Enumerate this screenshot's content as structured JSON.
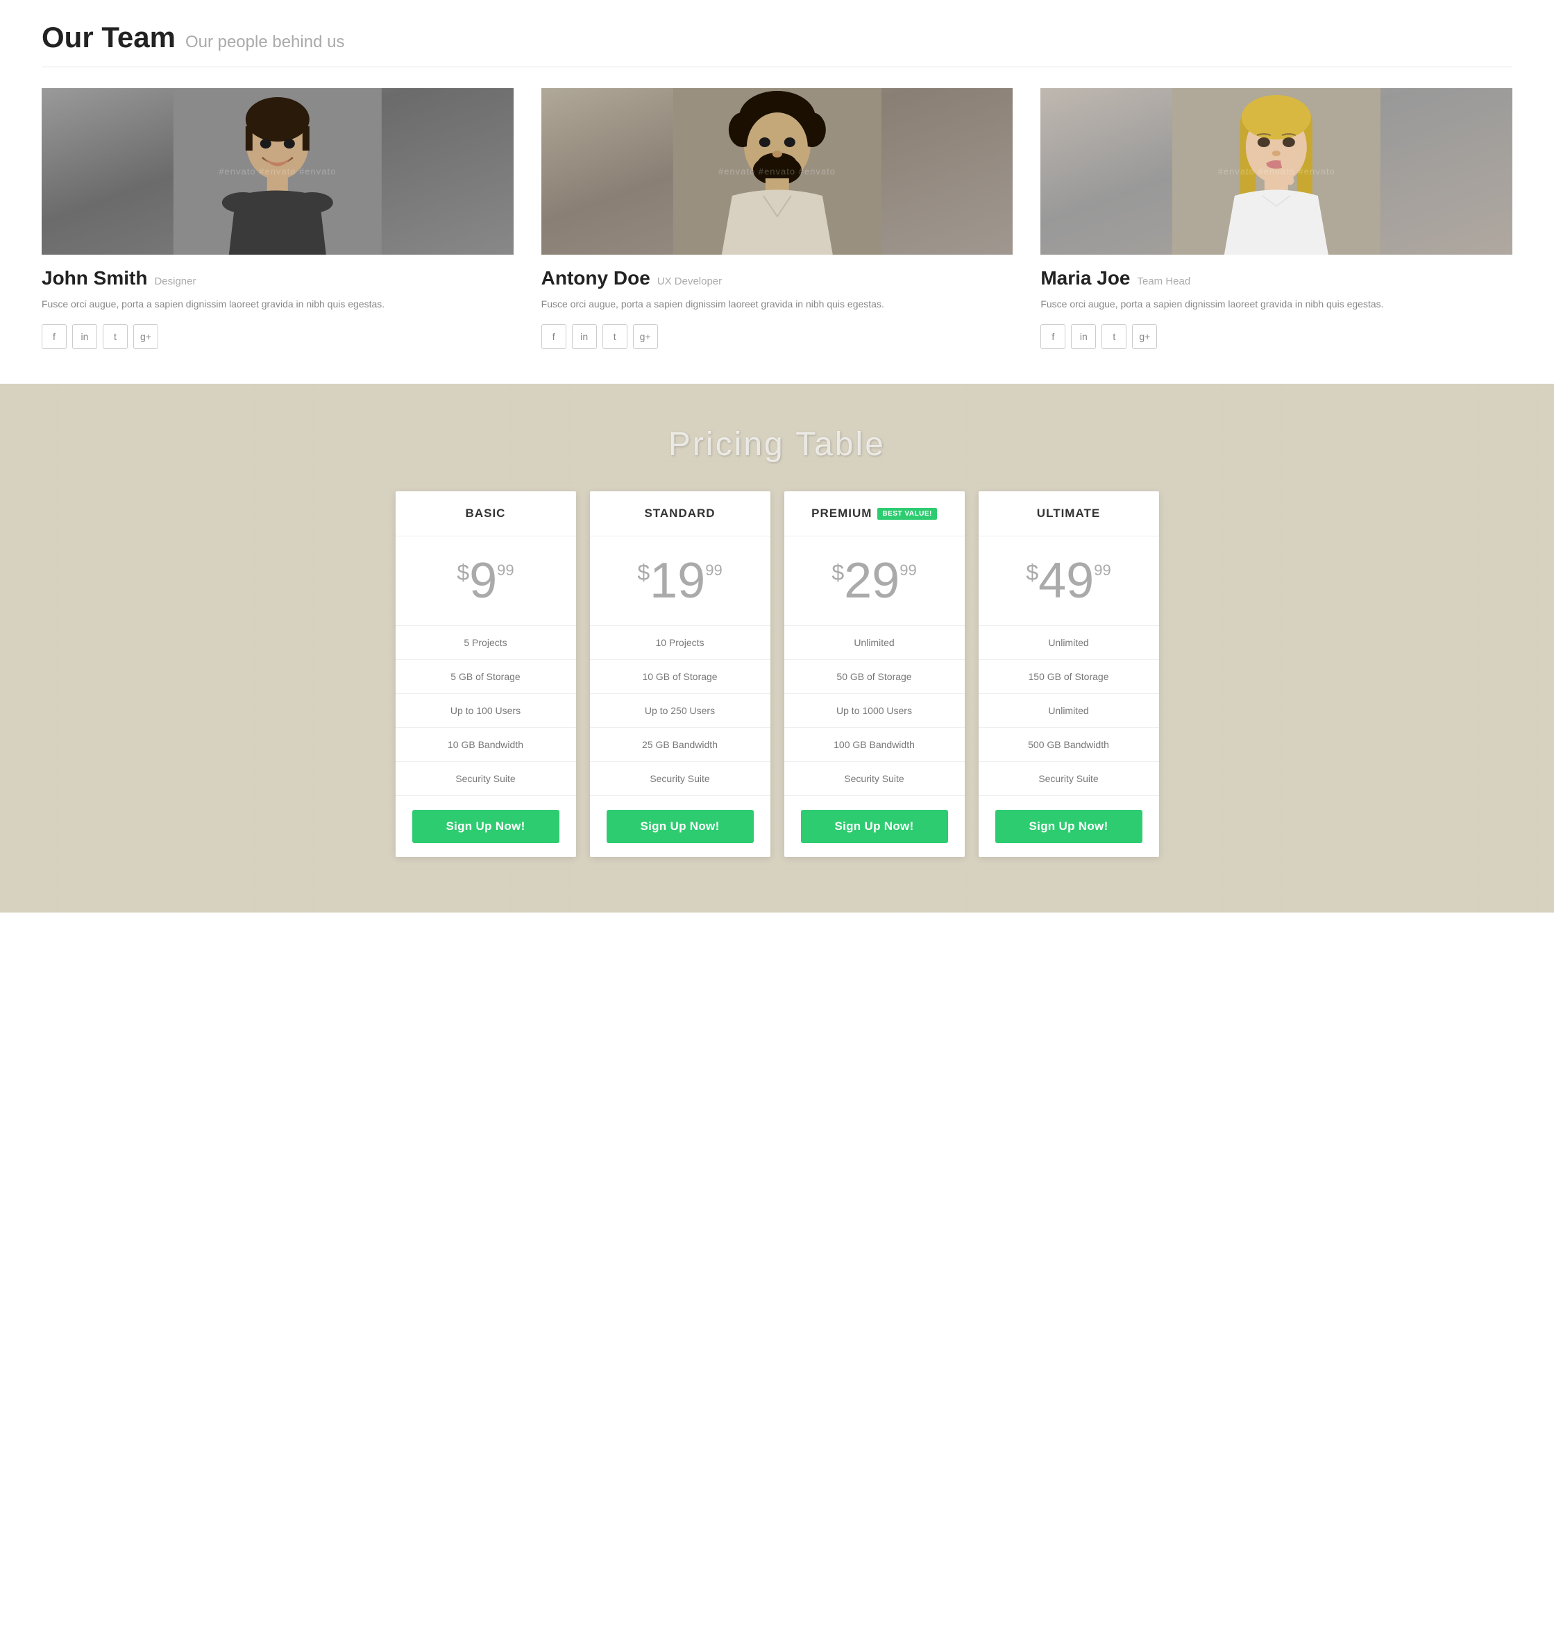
{
  "team": {
    "section_title": "Our Team",
    "section_subtitle": "Our people behind us",
    "members": [
      {
        "id": "john-smith",
        "name": "John Smith",
        "role": "Designer",
        "bio": "Fusce orci augue, porta a sapien dignissim laoreet gravida in nibh quis egestas.",
        "photo_class": "photo-john"
      },
      {
        "id": "antony-doe",
        "name": "Antony Doe",
        "role": "UX Developer",
        "bio": "Fusce orci augue, porta a sapien dignissim laoreet gravida in nibh quis egestas.",
        "photo_class": "photo-antony"
      },
      {
        "id": "maria-joe",
        "name": "Maria Joe",
        "role": "Team Head",
        "bio": "Fusce orci augue, porta a sapien dignissim laoreet gravida in nibh quis egestas.",
        "photo_class": "photo-maria"
      }
    ],
    "social_links": [
      "f",
      "in",
      "t",
      "g+"
    ]
  },
  "pricing": {
    "section_title": "Pricing Table",
    "plans": [
      {
        "id": "basic",
        "name": "BASIC",
        "badge": null,
        "price_dollar": "$",
        "price_main": "9",
        "price_cents": "99",
        "features": [
          "5 Projects",
          "5 GB of Storage",
          "Up to 100 Users",
          "10 GB Bandwidth",
          "Security Suite"
        ],
        "cta": "Sign Up Now!"
      },
      {
        "id": "standard",
        "name": "STANDARD",
        "badge": null,
        "price_dollar": "$",
        "price_main": "19",
        "price_cents": "99",
        "features": [
          "10 Projects",
          "10 GB of Storage",
          "Up to 250 Users",
          "25 GB Bandwidth",
          "Security Suite"
        ],
        "cta": "Sign Up Now!"
      },
      {
        "id": "premium",
        "name": "PREMIUM",
        "badge": "BEST VALUE!",
        "price_dollar": "$",
        "price_main": "29",
        "price_cents": "99",
        "features": [
          "Unlimited",
          "50 GB of Storage",
          "Up to 1000 Users",
          "100 GB Bandwidth",
          "Security Suite"
        ],
        "cta": "Sign Up Now!"
      },
      {
        "id": "ultimate",
        "name": "ULTIMATE",
        "badge": null,
        "price_dollar": "$",
        "price_main": "49",
        "price_cents": "99",
        "features": [
          "Unlimited",
          "150 GB of Storage",
          "Unlimited",
          "500 GB Bandwidth",
          "Security Suite"
        ],
        "cta": "Sign Up Now!"
      }
    ]
  }
}
